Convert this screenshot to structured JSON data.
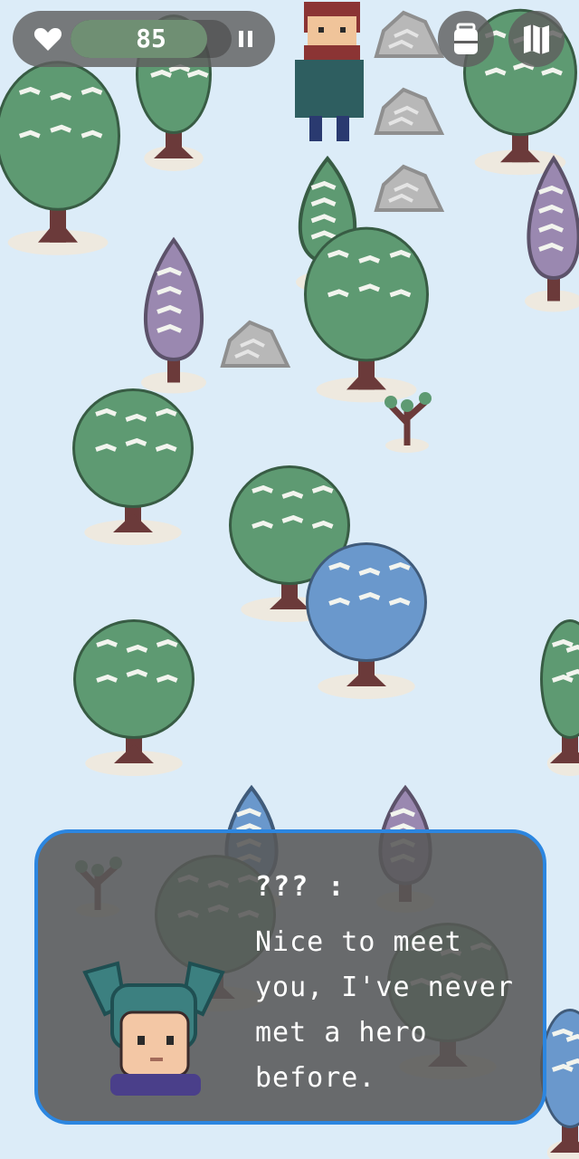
{
  "hud": {
    "health_value": "85",
    "health_fraction": 0.85,
    "health_icon": "heart-icon",
    "pause_icon": "pause-icon",
    "backpack_icon": "backpack-icon",
    "map_icon": "map-icon"
  },
  "dialog": {
    "speaker": "??? :",
    "message": "Nice to meet you, I've never met a hero before.",
    "border_color": "#2c86e0"
  },
  "colors": {
    "snow": "#dcecf8",
    "tree_green": "#5e9a72",
    "tree_purple": "#9a88b0",
    "tree_blue": "#6a98cc",
    "rock": "#b8b8b8",
    "hud_bg": "#5f5f5f"
  }
}
